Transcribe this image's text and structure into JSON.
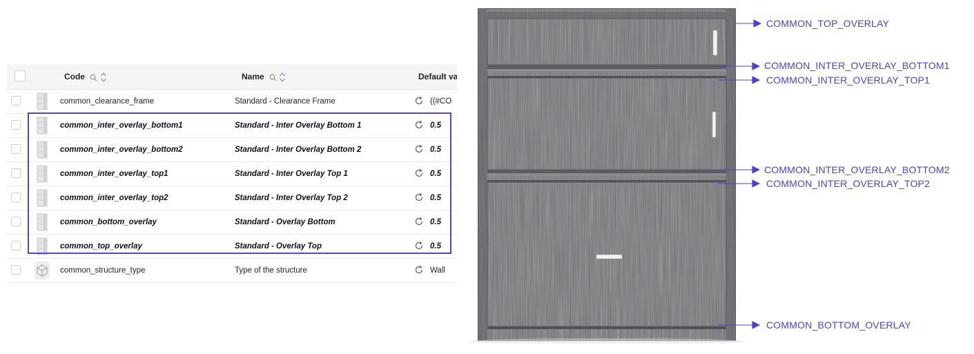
{
  "table": {
    "headers": {
      "code": "Code",
      "name": "Name",
      "default": "Default va"
    },
    "rows": [
      {
        "code": "common_clearance_frame",
        "name": "Standard - Clearance Frame",
        "value": "((#CO",
        "bold": false
      },
      {
        "code": "common_inter_overlay_bottom1",
        "name": "Standard - Inter Overlay Bottom 1",
        "value": "0.5",
        "bold": true
      },
      {
        "code": "common_inter_overlay_bottom2",
        "name": "Standard - Inter Overlay Bottom 2",
        "value": "0.5",
        "bold": true
      },
      {
        "code": "common_inter_overlay_top1",
        "name": "Standard - Inter Overlay Top 1",
        "value": "0.5",
        "bold": true
      },
      {
        "code": "common_inter_overlay_top2",
        "name": "Standard - Inter Overlay Top 2",
        "value": "0.5",
        "bold": true
      },
      {
        "code": "common_bottom_overlay",
        "name": "Standard - Overlay Bottom",
        "value": "0.5",
        "bold": true
      },
      {
        "code": "common_top_overlay",
        "name": "Standard - Overlay Top",
        "value": "0.5",
        "bold": true
      },
      {
        "code": "common_structure_type",
        "name": "Type of the structure",
        "value": "Wall",
        "bold": false
      }
    ]
  },
  "icons": {
    "header_search": "search-icon",
    "header_sort": "sort-icon",
    "value_refresh": "refresh-icon",
    "row_thumbnail": "cabinet-thumbnail-icon",
    "structure_thumbnail": "cube-icon"
  },
  "labels": {
    "top_overlay": "COMMON_TOP_OVERLAY",
    "inter_bottom1": "COMMON_INTER_OVERLAY_BOTTOM1",
    "inter_top1": "COMMON_INTER_OVERLAY_TOP1",
    "inter_bottom2": "COMMON_INTER_OVERLAY_BOTTOM2",
    "inter_top2": "COMMON_INTER_OVERLAY_TOP2",
    "bottom_overlay": "COMMON_BOTTOM_OVERLAY"
  },
  "colors": {
    "accent": "#4d3ce0",
    "highlight_border": "#5b3fd6",
    "cabinet_wood": "#6b6d70"
  }
}
